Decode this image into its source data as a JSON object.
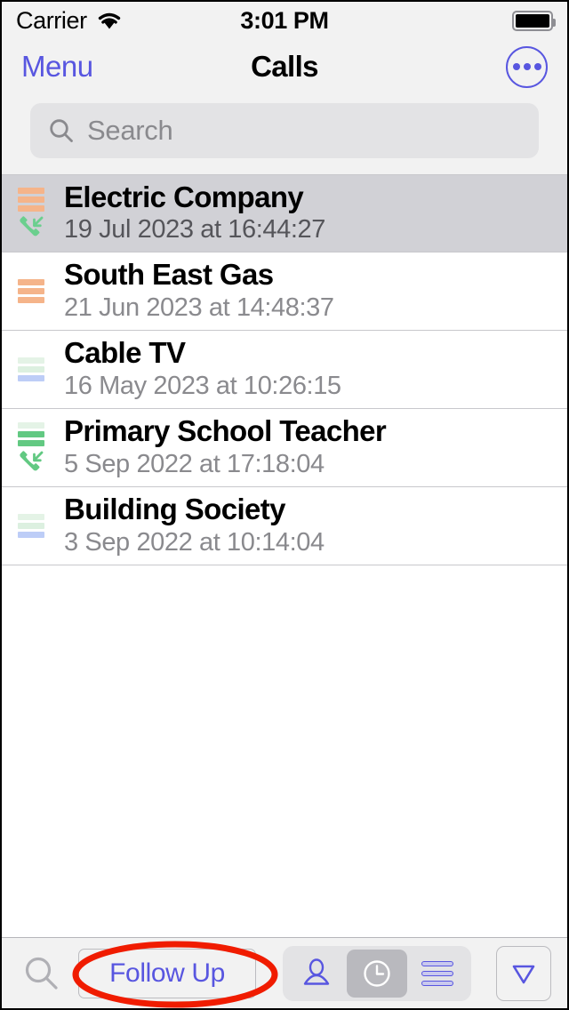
{
  "statusbar": {
    "carrier": "Carrier",
    "wifi_icon": "wifi-icon",
    "time": "3:01 PM",
    "battery_icon": "battery-full-icon"
  },
  "navbar": {
    "menu_label": "Menu",
    "title": "Calls",
    "more_icon": "more-circle-icon"
  },
  "search": {
    "icon": "search-icon",
    "placeholder": "Search",
    "value": ""
  },
  "list": {
    "rows": [
      {
        "title": "Electric Company",
        "subtitle": "19 Jul 2023 at 16:44:27",
        "selected": true,
        "bars": [
          "#f5b48a",
          "#f5b48a",
          "#f5b48a"
        ],
        "call_icon": "incoming-call-icon",
        "call_icon_color": "#6bcf8e"
      },
      {
        "title": "South East Gas",
        "subtitle": "21 Jun 2023 at 14:48:37",
        "selected": false,
        "bars": [
          "#f5b48a",
          "#f5b48a",
          "#f5b48a"
        ],
        "call_icon": null,
        "call_icon_color": null
      },
      {
        "title": "Cable TV",
        "subtitle": "16 May 2023 at 10:26:15",
        "selected": false,
        "bars": [
          "#e4f3e6",
          "#dcf0e0",
          "#bdcdf7"
        ],
        "call_icon": null,
        "call_icon_color": null
      },
      {
        "title": "Primary School Teacher",
        "subtitle": "5 Sep 2022 at 17:18:04",
        "selected": false,
        "bars": [
          "#e4f3e6",
          "#62c982",
          "#62c982"
        ],
        "call_icon": "incoming-call-icon",
        "call_icon_color": "#62c982"
      },
      {
        "title": "Building Society",
        "subtitle": "3 Sep 2022 at 10:14:04",
        "selected": false,
        "bars": [
          "#e4f3e6",
          "#dcf0e0",
          "#bdcdf7"
        ],
        "call_icon": null,
        "call_icon_color": null
      }
    ]
  },
  "toolbar": {
    "search_icon": "search-icon",
    "follow_up_label": "Follow Up",
    "segmented": [
      {
        "icon": "person-icon",
        "active": false
      },
      {
        "icon": "clock-icon",
        "active": true
      },
      {
        "icon": "list-lines-icon",
        "active": false
      }
    ],
    "filter_icon": "filter-triangle-icon"
  },
  "annotation": {
    "shape": "red-ellipse-highlight",
    "color": "#f01c00",
    "target": "Follow Up"
  },
  "colors": {
    "accent": "#5856e0",
    "chrome": "#f2f2f2",
    "selected_row": "#d1d1d6",
    "separator": "#c8c8cc",
    "subtitle": "#8a8a8e",
    "annotation": "#f01c00"
  }
}
